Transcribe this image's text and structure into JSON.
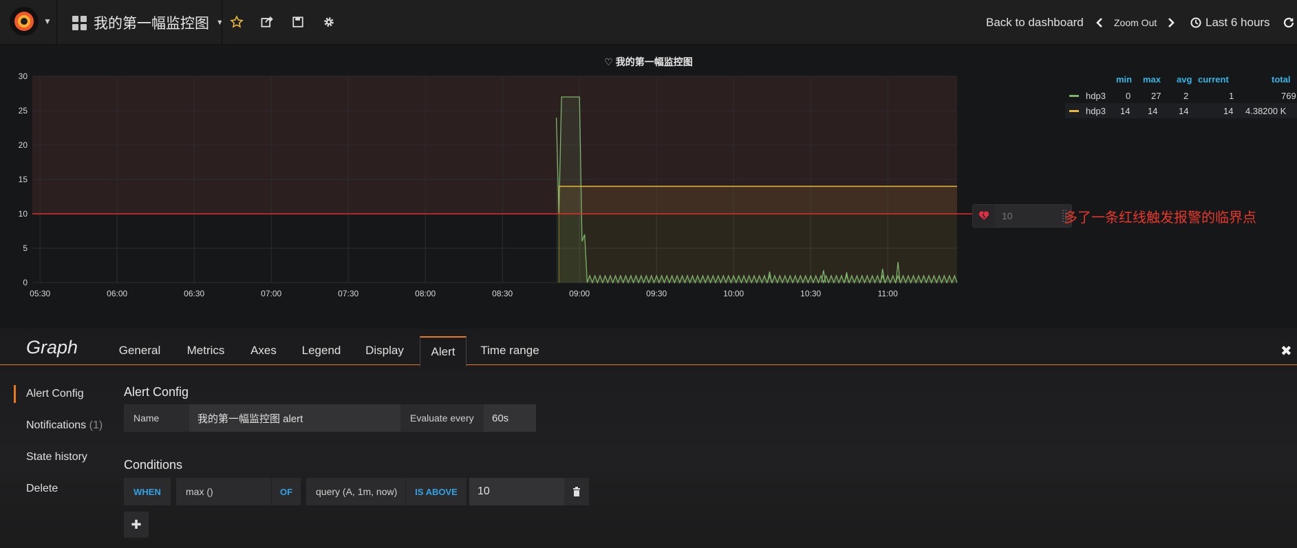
{
  "navbar": {
    "dashboard_title": "我的第一幅监控图",
    "back_label": "Back to dashboard",
    "zoom_out_label": "Zoom Out",
    "time_range_label": "Last 6 hours"
  },
  "panel": {
    "title": "我的第一幅监控图"
  },
  "chart_data": {
    "type": "line",
    "title": "我的第一幅监控图",
    "y_ticks": [
      "30",
      "25",
      "20",
      "15",
      "10",
      "5",
      "0"
    ],
    "ylim": [
      0,
      30
    ],
    "x_ticks": [
      "05:30",
      "06:00",
      "06:30",
      "07:00",
      "07:30",
      "08:00",
      "08:30",
      "09:00",
      "09:30",
      "10:00",
      "10:30",
      "11:00"
    ],
    "xlim": [
      "05:27",
      "11:27"
    ],
    "grid": true,
    "threshold": 10,
    "series": [
      {
        "name": "hdp3",
        "color": "#7eb26d",
        "note_hint": "spike near 08:52-09:00 then oscillation between 0 and 1",
        "points": [
          [
            "08:51",
            24
          ],
          [
            "08:52",
            10
          ],
          [
            "08:53",
            27
          ],
          [
            "08:54",
            27
          ],
          [
            "08:56",
            27
          ],
          [
            "08:58",
            27
          ],
          [
            "09:00",
            27
          ],
          [
            "09:01",
            6
          ],
          [
            "09:02",
            7
          ],
          [
            "09:03",
            0
          ]
        ],
        "baseline_oscillation": {
          "from": "09:03",
          "to": "11:27",
          "min": 0,
          "max": 1
        }
      },
      {
        "name": "hdp3",
        "color": "#eab839",
        "points": [
          [
            "08:52",
            14
          ],
          [
            "11:27",
            14
          ]
        ]
      }
    ]
  },
  "legend": {
    "headers": [
      "min",
      "max",
      "avg",
      "current",
      "total"
    ],
    "rows": [
      {
        "name": "hdp3",
        "color": "#7eb26d",
        "min": "0",
        "max": "27",
        "avg": "2",
        "current": "1",
        "total": "769"
      },
      {
        "name": "hdp3",
        "color": "#eab839",
        "min": "14",
        "max": "14",
        "avg": "14",
        "current": "14",
        "total": "4.38200 K"
      }
    ]
  },
  "threshold_handle": {
    "value": "10"
  },
  "annotation": "多了一条红线触发报警的临界点",
  "editor": {
    "title": "Graph",
    "tabs": [
      "General",
      "Metrics",
      "Axes",
      "Legend",
      "Display",
      "Alert",
      "Time range"
    ],
    "active_tab": "Alert",
    "side": {
      "alert_config": "Alert Config",
      "notifications": "Notifications",
      "notifications_count": "(1)",
      "state_history": "State history",
      "delete": "Delete"
    },
    "alert_config": {
      "section_title": "Alert Config",
      "name_label": "Name",
      "name_value": "我的第一幅监控图 alert",
      "evaluate_label": "Evaluate every",
      "evaluate_value": "60s"
    },
    "conditions": {
      "section_title": "Conditions",
      "when": "WHEN",
      "func": "max ()",
      "of": "OF",
      "query": "query (A, 1m, now)",
      "is_above": "IS ABOVE",
      "value": "10"
    }
  }
}
